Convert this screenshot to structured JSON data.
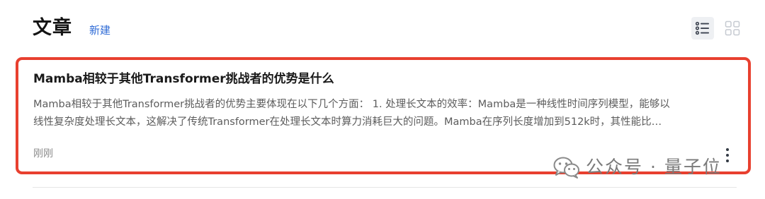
{
  "header": {
    "title": "文章",
    "new_label": "新建"
  },
  "view_toggle": {
    "list_icon": "list-view-icon",
    "grid_icon": "grid-view-icon",
    "active": "list"
  },
  "article": {
    "title": "Mamba相较于其他Transformer挑战者的优势是什么",
    "excerpt_line1": "Mamba相较于其他Transformer挑战者的优势主要体现在以下几个方面： 1. 处理长文本的效率：Mamba是一种线性时间序列模型，能够以",
    "excerpt_line2": "线性复杂度处理长文本，这解决了传统Transformer在处理长文本时算力消耗巨大的问题。Mamba在序列长度增加到512k时，其性能比…",
    "time": "刚刚",
    "more_icon": "more-vertical-icon"
  },
  "watermark": {
    "text": "公众号 · 量子位",
    "icon": "wechat-icon"
  },
  "colors": {
    "accent": "#2f6bd6",
    "highlight_border": "#e8402f"
  }
}
